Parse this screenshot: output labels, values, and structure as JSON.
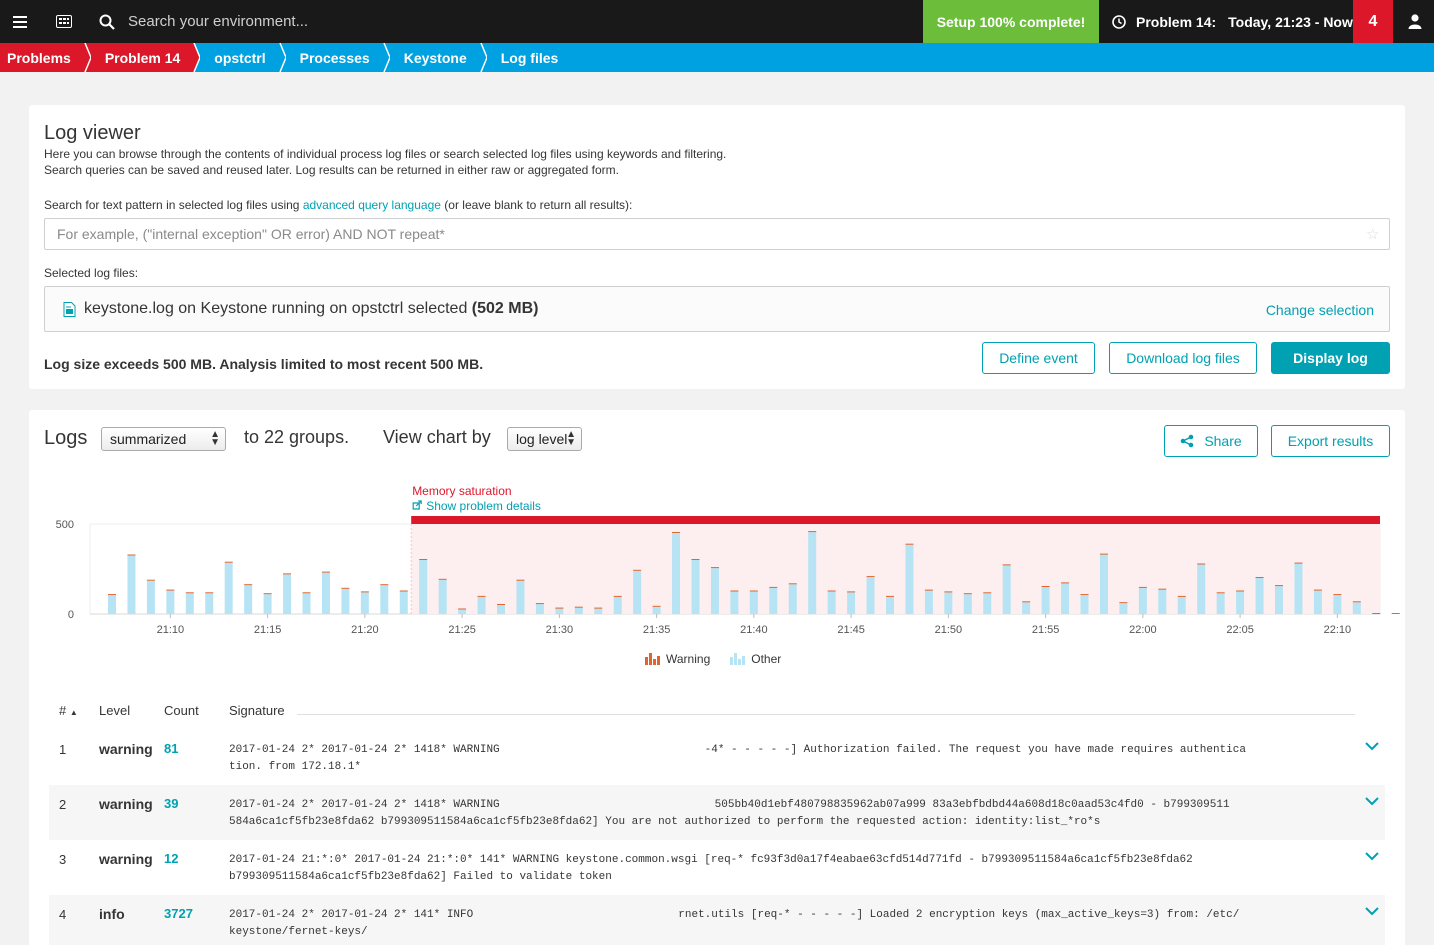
{
  "topbar": {
    "search_placeholder": "Search your environment...",
    "setup_label": "Setup 100% complete!",
    "problem_label": "Problem 14:",
    "timeframe": "Today, 21:23 - Now",
    "problem_count": "4"
  },
  "breadcrumb": [
    {
      "label": "Problems",
      "style": "red"
    },
    {
      "label": "Problem 14",
      "style": "red"
    },
    {
      "label": "opstctrl",
      "style": "blue"
    },
    {
      "label": "Processes",
      "style": "blue"
    },
    {
      "label": "Keystone",
      "style": "blue"
    },
    {
      "label": "Log files",
      "style": "blue"
    }
  ],
  "log_viewer": {
    "title": "Log viewer",
    "desc1": "Here you can browse through the contents of individual process log files or search selected log files using keywords and filtering.",
    "desc2": "Search queries can be saved and reused later. Log results can be returned in either raw or aggregated form.",
    "search_label_pre": "Search for text pattern in selected log files using ",
    "search_label_link": "advanced query language",
    "search_label_post": " (or leave blank to return all results):",
    "query_placeholder": "For example, (\"internal exception\" OR error) AND NOT repeat*",
    "query_value": "",
    "selected_label": "Selected log files:",
    "file_text": "keystone.log on Keystone running on opstctrl selected ",
    "file_size": "(502 MB)",
    "change_selection": "Change selection",
    "size_warning": "Log size exceeds 500 MB. Analysis limited to most recent 500 MB.",
    "buttons": {
      "define_event": "Define event",
      "download": "Download log files",
      "display": "Display log"
    }
  },
  "logs": {
    "title": "Logs",
    "mode_value": "summarized",
    "groups_text": "to 22 groups.",
    "view_by_text": "View chart by",
    "view_by_value": "log level",
    "share_label": "Share",
    "export_label": "Export results"
  },
  "chart_data": {
    "type": "bar",
    "ylim": [
      0,
      500
    ],
    "yticks": [
      "0",
      "500"
    ],
    "x_start": "21:07",
    "x_step_minutes": 1,
    "tick_labels": [
      "21:10",
      "21:15",
      "21:20",
      "21:25",
      "21:30",
      "21:35",
      "21:40",
      "21:45",
      "21:50",
      "21:55",
      "22:00",
      "22:05",
      "22:10"
    ],
    "tick_values": [
      "21:10",
      "21:15",
      "21:20",
      "21:25",
      "21:30",
      "21:35",
      "21:40",
      "21:45",
      "21:50",
      "21:55",
      "22:00",
      "22:05",
      "22:10"
    ],
    "series": [
      {
        "name": "Warning",
        "color": "#e0642e",
        "values": [
          2,
          4,
          3,
          2,
          2,
          2,
          3,
          2,
          2,
          3,
          3,
          2,
          2,
          2,
          4,
          2,
          2,
          2,
          3,
          2,
          2,
          2,
          2,
          2,
          2,
          3,
          4,
          2,
          2,
          2,
          2,
          2,
          3,
          2,
          2,
          2,
          2,
          2,
          2,
          2,
          2,
          4,
          2,
          2,
          2,
          2,
          2,
          2,
          2,
          2,
          2,
          2,
          2,
          2,
          2,
          2,
          2,
          2,
          2,
          2,
          2,
          2,
          2,
          2,
          2,
          2,
          2
        ]
      },
      {
        "name": "Other",
        "color": "#b6e4f5",
        "values": [
          105,
          325,
          185,
          130,
          115,
          115,
          285,
          160,
          110,
          220,
          115,
          230,
          140,
          120,
          160,
          125,
          300,
          190,
          25,
          95,
          50,
          185,
          55,
          30,
          35,
          30,
          95,
          240,
          40,
          450,
          300,
          255,
          125,
          125,
          145,
          165,
          455,
          125,
          120,
          205,
          95,
          385,
          130,
          120,
          110,
          115,
          270,
          65,
          150,
          170,
          105,
          330,
          60,
          145,
          135,
          95,
          275,
          115,
          125,
          200,
          155,
          280,
          130,
          105,
          65,
          0,
          0
        ]
      }
    ],
    "annotation": {
      "label": "Memory saturation",
      "link": "Show problem details",
      "start": "21:23",
      "end": "Now"
    },
    "legend_position": "bottom-center"
  },
  "table": {
    "headers": {
      "num": "#",
      "level": "Level",
      "count": "Count",
      "signature": "Signature"
    },
    "rows": [
      {
        "num": "1",
        "level": "warning",
        "count": "81",
        "line1a": "2017-01-24 2* 2017-01-24 2* 1418* WARNING",
        "line1b": "-4* - - - - -] Authorization failed. The request you have made requires authentica",
        "line2": "tion. from 172.18.1*"
      },
      {
        "num": "2",
        "level": "warning",
        "count": "39",
        "line1a": "2017-01-24 2* 2017-01-24 2* 1418* WARNING",
        "line1b": "505bb40d1ebf480798835962ab07a999 83a3ebfbdbd44a608d18c0aad53c4fd0 - b799309511",
        "line2": "584a6ca1cf5fb23e8fda62 b799309511584a6ca1cf5fb23e8fda62] You are not authorized to perform the requested action: identity:list_*ro*s"
      },
      {
        "num": "3",
        "level": "warning",
        "count": "12",
        "line1a": "2017-01-24 21:*:0* 2017-01-24 21:*:0* 141* WARNING keystone.common.wsgi [req-* fc93f3d0a17f4eabae63cfd514d771fd - b799309511584a6ca1cf5fb23e8fda62",
        "line1b": "",
        "line2": "b799309511584a6ca1cf5fb23e8fda62] Failed to validate token"
      },
      {
        "num": "4",
        "level": "info",
        "count": "3727",
        "line1a": "2017-01-24 2* 2017-01-24 2* 141* INFO",
        "line1b": "rnet.utils [req-* - - - - -] Loaded 2 encryption keys (max_active_keys=3) from: /etc/",
        "line2": "keystone/fernet-keys/"
      }
    ]
  },
  "colors": {
    "accent": "#00a1b2",
    "breadcrumb_blue": "#00a1e0",
    "problem_red": "#dc172a",
    "setup_green": "#6bbd3a"
  }
}
